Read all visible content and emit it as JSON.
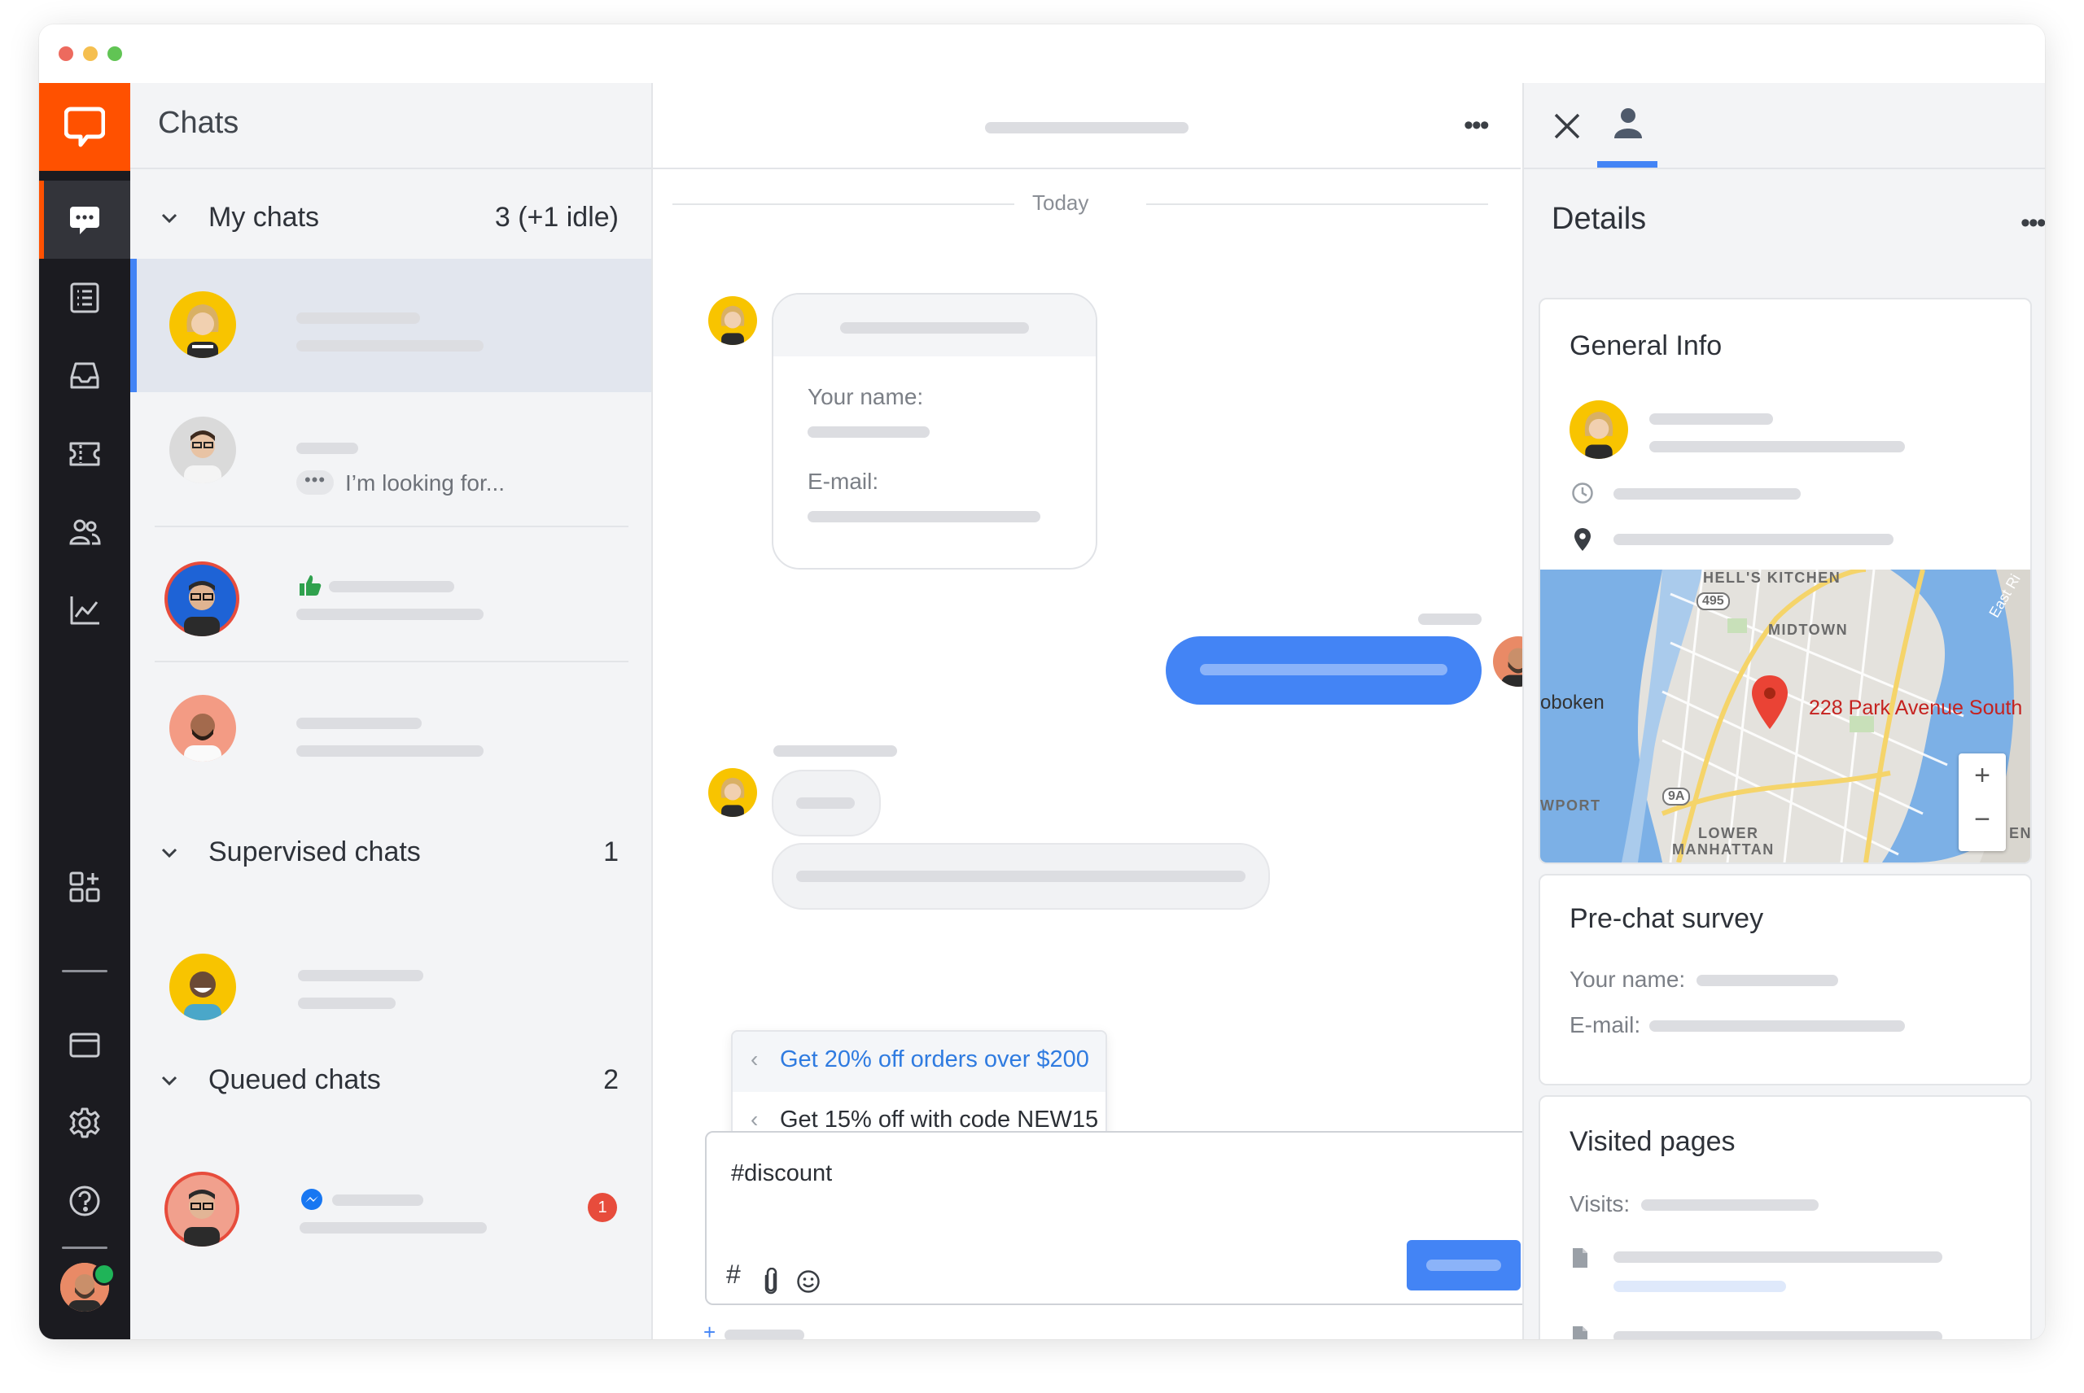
{
  "app": {
    "colors": {
      "brand": "#ff5100",
      "accent": "#4384f5",
      "rail": "#1b1b20",
      "badge": "#e74c3c",
      "online": "#1fb458"
    }
  },
  "nav": {
    "items": [
      {
        "icon": "chats-icon",
        "active": true
      },
      {
        "icon": "archives-icon"
      },
      {
        "icon": "inbox-icon"
      },
      {
        "icon": "tickets-icon"
      },
      {
        "icon": "customers-icon"
      },
      {
        "icon": "reports-icon"
      },
      {
        "icon": "apps-icon"
      },
      {
        "icon": "billing-icon"
      },
      {
        "icon": "settings-icon"
      },
      {
        "icon": "help-icon"
      }
    ]
  },
  "list": {
    "title": "Chats",
    "my_chats": {
      "label": "My chats",
      "count": "3 (+1 idle)"
    },
    "my_chat_rows": [
      {
        "selected": true
      },
      {
        "preview": "I’m looking for...",
        "typing": "•••"
      },
      {
        "reaction": "thumbs-up-icon"
      },
      {}
    ],
    "supervised": {
      "label": "Supervised chats",
      "count": "1"
    },
    "queued": {
      "label": "Queued chats",
      "count": "2"
    },
    "queued_rows": [
      {
        "source": "messenger-icon",
        "unread": "1"
      }
    ]
  },
  "chat": {
    "date_divider": "Today",
    "form": {
      "name_label": "Your name:",
      "email_label": "E-mail:"
    },
    "suggestions": [
      {
        "text": "Get 20% off orders over $200",
        "highlighted": true
      },
      {
        "text": "Get 15% off with code NEW15"
      }
    ],
    "composer": {
      "value": "#discount",
      "tools": [
        "hash-icon",
        "attachment-icon",
        "emoji-icon"
      ]
    },
    "add_label": "+"
  },
  "details": {
    "title": "Details",
    "general": {
      "title": "General Info"
    },
    "map": {
      "pin_label": "228 Park Avenue South",
      "labels": [
        "HELL'S KITCHEN",
        "MIDTOWN",
        "oboken",
        "WPORT",
        "LOWER",
        "MANHATTAN",
        "495",
        "9A",
        "East Ri",
        "ENP"
      ],
      "zoom_in": "+",
      "zoom_out": "−"
    },
    "prechat": {
      "title": "Pre-chat survey",
      "name_label": "Your name:",
      "email_label": "E-mail:"
    },
    "visited": {
      "title": "Visited pages",
      "visits_label": "Visits:"
    }
  }
}
